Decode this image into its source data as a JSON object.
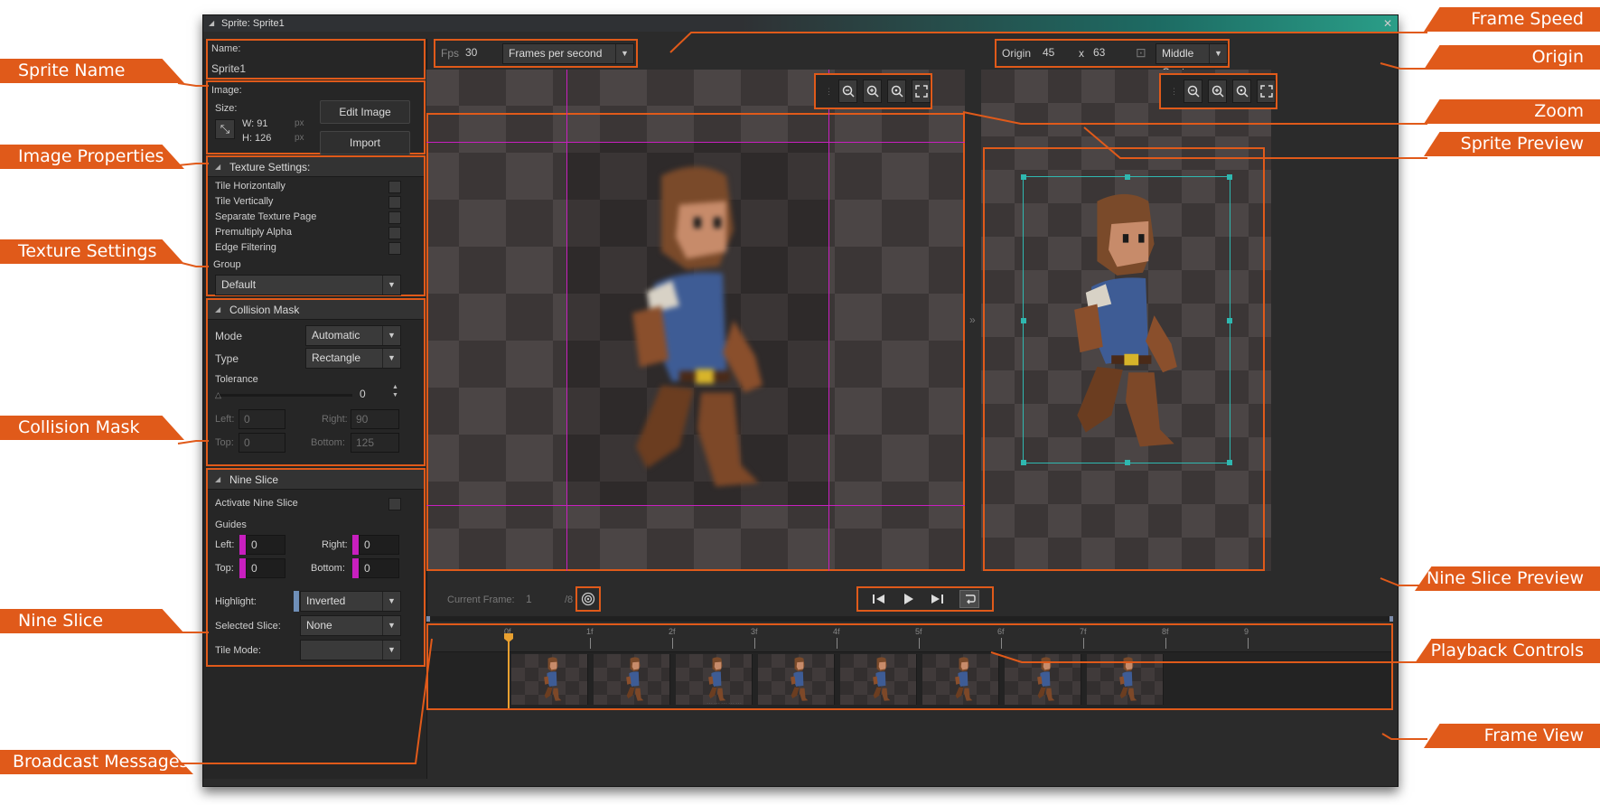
{
  "window": {
    "title": "Sprite: Sprite1"
  },
  "name": {
    "label": "Name:",
    "value": "Sprite1"
  },
  "image": {
    "label": "Image:",
    "size_label": "Size:",
    "width": "W: 91",
    "height": "H: 126",
    "unit": "px",
    "edit_button": "Edit Image",
    "import_button": "Import"
  },
  "texture": {
    "header": "Texture Settings:",
    "options": [
      "Tile Horizontally",
      "Tile Vertically",
      "Separate Texture Page",
      "Premultiply Alpha",
      "Edge Filtering"
    ],
    "group_label": "Group",
    "group_value": "Default"
  },
  "collision": {
    "header": "Collision Mask",
    "mode_label": "Mode",
    "mode_value": "Automatic",
    "type_label": "Type",
    "type_value": "Rectangle",
    "tolerance_label": "Tolerance",
    "tolerance_value": "0",
    "left_label": "Left:",
    "left_value": "0",
    "right_label": "Right:",
    "right_value": "90",
    "top_label": "Top:",
    "top_value": "0",
    "bottom_label": "Bottom:",
    "bottom_value": "125"
  },
  "nine_slice": {
    "header": "Nine Slice",
    "activate_label": "Activate Nine Slice",
    "guides_label": "Guides",
    "left_label": "Left:",
    "left_value": "0",
    "right_label": "Right:",
    "right_value": "0",
    "top_label": "Top:",
    "top_value": "0",
    "bottom_label": "Bottom:",
    "bottom_value": "0",
    "highlight_label": "Highlight:",
    "highlight_value": "Inverted",
    "selected_label": "Selected Slice:",
    "selected_value": "None",
    "tile_label": "Tile Mode:",
    "tile_value": ""
  },
  "fps": {
    "label": "Fps",
    "value": "30",
    "mode": "Frames per second"
  },
  "origin": {
    "label": "Origin",
    "x": "45",
    "sep": "x",
    "y": "63",
    "preset": "Middle Centre"
  },
  "playback": {
    "current_label": "Current Frame:",
    "current_value": "1",
    "total": "/8"
  },
  "timeline": {
    "ticks": [
      "0f",
      "1f",
      "2f",
      "3f",
      "4f",
      "5f",
      "6f",
      "7f",
      "8f",
      "9"
    ]
  },
  "callouts": {
    "sprite_name": "Sprite Name",
    "image_properties": "Image Properties",
    "texture_settings": "Texture Settings",
    "collision_mask": "Collision Mask",
    "nine_slice": "Nine Slice",
    "broadcast_messages": "Broadcast Messages",
    "frame_speed": "Frame Speed",
    "origin": "Origin",
    "zoom": "Zoom",
    "sprite_preview": "Sprite Preview",
    "nine_slice_preview": "Nine Slice Preview",
    "playback_controls": "Playback Controls",
    "frame_view": "Frame View"
  },
  "colors": {
    "accent": "#e05a1a",
    "guide": "#c81fbf",
    "bbox": "#2fb8b0",
    "panel": "#2b2b2b"
  }
}
